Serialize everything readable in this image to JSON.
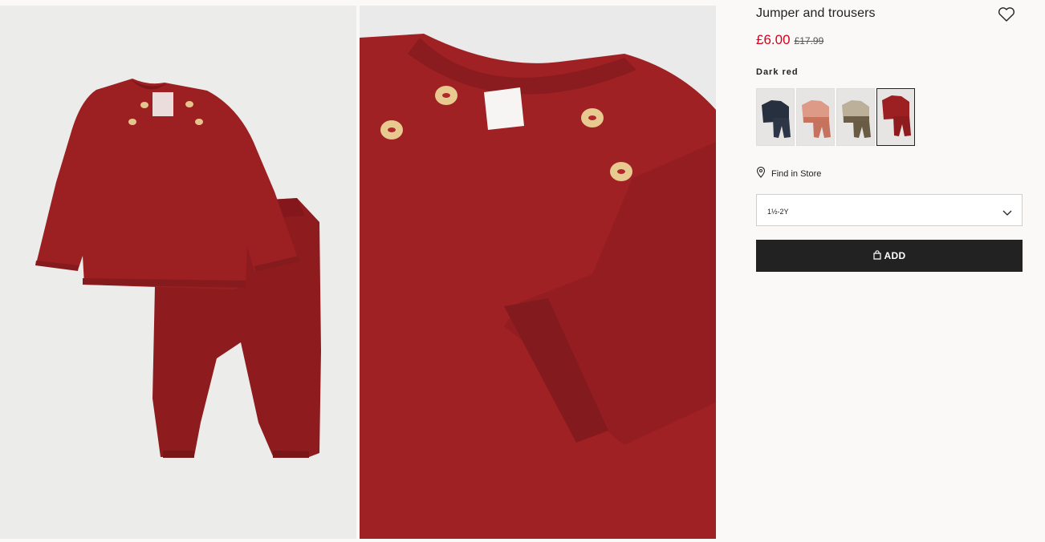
{
  "product": {
    "title": "Jumper and trousers",
    "price_current": "£6.00",
    "price_original": "£17.99",
    "color_label": "Dark red"
  },
  "colors": {
    "sale_price": "#d6001c",
    "button_bg": "#222222",
    "garment_red": "#9c1f22"
  },
  "swatches": [
    {
      "name": "Dark blue",
      "selected": false
    },
    {
      "name": "Pink",
      "selected": false
    },
    {
      "name": "Beige",
      "selected": false
    },
    {
      "name": "Dark red",
      "selected": true
    }
  ],
  "find_in_store": "Find in Store",
  "size_select": {
    "value": "1½-2Y"
  },
  "add_button": {
    "label": "ADD"
  },
  "icons": {
    "wishlist": "heart-icon",
    "store": "location-pin-icon",
    "select": "chevron-down-icon",
    "bag": "shopping-bag-icon"
  }
}
